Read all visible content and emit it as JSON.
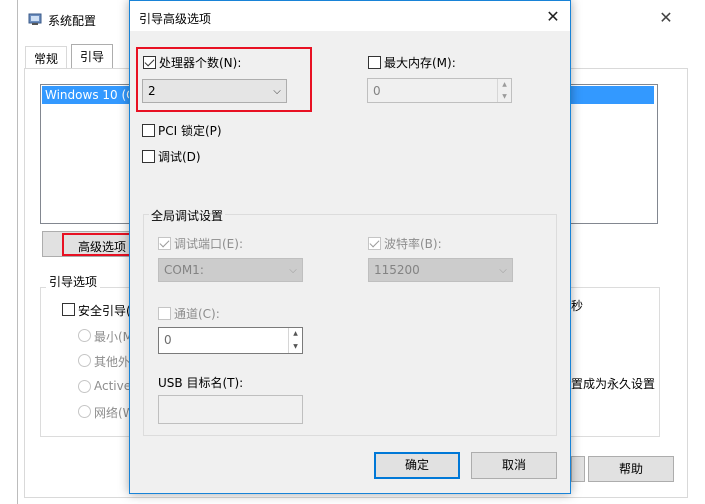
{
  "background_window": {
    "title": "系统配置",
    "tabs": [
      "常规",
      "引导"
    ],
    "list_item": "Windows 10 (C",
    "advanced_button": "高级选项",
    "boot_options_group": "引导选项",
    "safe_boot": "安全引导(",
    "radio_items": [
      "最小(M",
      "其他外",
      "Active",
      "网络(W"
    ],
    "partial_right_1": "秒",
    "partial_right_2": "置成为永久设置",
    "help_button": "帮助"
  },
  "dialog": {
    "title": "引导高级选项",
    "processor_count": {
      "label": "处理器个数(N):",
      "checked": true,
      "value": "2"
    },
    "max_memory": {
      "label": "最大内存(M):",
      "checked": false,
      "value": "0"
    },
    "pci_lock": {
      "label": "PCI 锁定(P)",
      "checked": false
    },
    "debug": {
      "label": "调试(D)",
      "checked": false
    },
    "global_debug_group": "全局调试设置",
    "debug_port": {
      "label": "调试端口(E):",
      "checked": true,
      "value": "COM1:"
    },
    "baud_rate": {
      "label": "波特率(B):",
      "checked": true,
      "value": "115200"
    },
    "channel": {
      "label": "通道(C):",
      "checked": false,
      "value": "0"
    },
    "usb_target": {
      "label": "USB 目标名(T):",
      "value": ""
    },
    "ok_button": "确定",
    "cancel_button": "取消"
  },
  "colors": {
    "accent": "#0078d7",
    "highlight": "#e81123",
    "selection": "#3399ff"
  }
}
